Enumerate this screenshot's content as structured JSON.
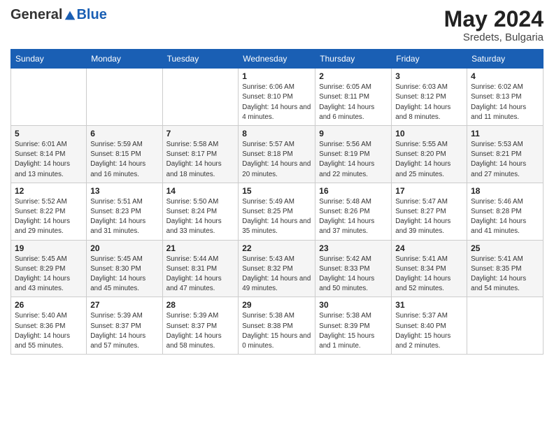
{
  "header": {
    "logo_general": "General",
    "logo_blue": "Blue",
    "month_year": "May 2024",
    "location": "Sredets, Bulgaria"
  },
  "weekdays": [
    "Sunday",
    "Monday",
    "Tuesday",
    "Wednesday",
    "Thursday",
    "Friday",
    "Saturday"
  ],
  "weeks": [
    [
      null,
      null,
      null,
      {
        "day": "1",
        "sunrise": "Sunrise: 6:06 AM",
        "sunset": "Sunset: 8:10 PM",
        "daylight": "Daylight: 14 hours and 4 minutes."
      },
      {
        "day": "2",
        "sunrise": "Sunrise: 6:05 AM",
        "sunset": "Sunset: 8:11 PM",
        "daylight": "Daylight: 14 hours and 6 minutes."
      },
      {
        "day": "3",
        "sunrise": "Sunrise: 6:03 AM",
        "sunset": "Sunset: 8:12 PM",
        "daylight": "Daylight: 14 hours and 8 minutes."
      },
      {
        "day": "4",
        "sunrise": "Sunrise: 6:02 AM",
        "sunset": "Sunset: 8:13 PM",
        "daylight": "Daylight: 14 hours and 11 minutes."
      }
    ],
    [
      {
        "day": "5",
        "sunrise": "Sunrise: 6:01 AM",
        "sunset": "Sunset: 8:14 PM",
        "daylight": "Daylight: 14 hours and 13 minutes."
      },
      {
        "day": "6",
        "sunrise": "Sunrise: 5:59 AM",
        "sunset": "Sunset: 8:15 PM",
        "daylight": "Daylight: 14 hours and 16 minutes."
      },
      {
        "day": "7",
        "sunrise": "Sunrise: 5:58 AM",
        "sunset": "Sunset: 8:17 PM",
        "daylight": "Daylight: 14 hours and 18 minutes."
      },
      {
        "day": "8",
        "sunrise": "Sunrise: 5:57 AM",
        "sunset": "Sunset: 8:18 PM",
        "daylight": "Daylight: 14 hours and 20 minutes."
      },
      {
        "day": "9",
        "sunrise": "Sunrise: 5:56 AM",
        "sunset": "Sunset: 8:19 PM",
        "daylight": "Daylight: 14 hours and 22 minutes."
      },
      {
        "day": "10",
        "sunrise": "Sunrise: 5:55 AM",
        "sunset": "Sunset: 8:20 PM",
        "daylight": "Daylight: 14 hours and 25 minutes."
      },
      {
        "day": "11",
        "sunrise": "Sunrise: 5:53 AM",
        "sunset": "Sunset: 8:21 PM",
        "daylight": "Daylight: 14 hours and 27 minutes."
      }
    ],
    [
      {
        "day": "12",
        "sunrise": "Sunrise: 5:52 AM",
        "sunset": "Sunset: 8:22 PM",
        "daylight": "Daylight: 14 hours and 29 minutes."
      },
      {
        "day": "13",
        "sunrise": "Sunrise: 5:51 AM",
        "sunset": "Sunset: 8:23 PM",
        "daylight": "Daylight: 14 hours and 31 minutes."
      },
      {
        "day": "14",
        "sunrise": "Sunrise: 5:50 AM",
        "sunset": "Sunset: 8:24 PM",
        "daylight": "Daylight: 14 hours and 33 minutes."
      },
      {
        "day": "15",
        "sunrise": "Sunrise: 5:49 AM",
        "sunset": "Sunset: 8:25 PM",
        "daylight": "Daylight: 14 hours and 35 minutes."
      },
      {
        "day": "16",
        "sunrise": "Sunrise: 5:48 AM",
        "sunset": "Sunset: 8:26 PM",
        "daylight": "Daylight: 14 hours and 37 minutes."
      },
      {
        "day": "17",
        "sunrise": "Sunrise: 5:47 AM",
        "sunset": "Sunset: 8:27 PM",
        "daylight": "Daylight: 14 hours and 39 minutes."
      },
      {
        "day": "18",
        "sunrise": "Sunrise: 5:46 AM",
        "sunset": "Sunset: 8:28 PM",
        "daylight": "Daylight: 14 hours and 41 minutes."
      }
    ],
    [
      {
        "day": "19",
        "sunrise": "Sunrise: 5:45 AM",
        "sunset": "Sunset: 8:29 PM",
        "daylight": "Daylight: 14 hours and 43 minutes."
      },
      {
        "day": "20",
        "sunrise": "Sunrise: 5:45 AM",
        "sunset": "Sunset: 8:30 PM",
        "daylight": "Daylight: 14 hours and 45 minutes."
      },
      {
        "day": "21",
        "sunrise": "Sunrise: 5:44 AM",
        "sunset": "Sunset: 8:31 PM",
        "daylight": "Daylight: 14 hours and 47 minutes."
      },
      {
        "day": "22",
        "sunrise": "Sunrise: 5:43 AM",
        "sunset": "Sunset: 8:32 PM",
        "daylight": "Daylight: 14 hours and 49 minutes."
      },
      {
        "day": "23",
        "sunrise": "Sunrise: 5:42 AM",
        "sunset": "Sunset: 8:33 PM",
        "daylight": "Daylight: 14 hours and 50 minutes."
      },
      {
        "day": "24",
        "sunrise": "Sunrise: 5:41 AM",
        "sunset": "Sunset: 8:34 PM",
        "daylight": "Daylight: 14 hours and 52 minutes."
      },
      {
        "day": "25",
        "sunrise": "Sunrise: 5:41 AM",
        "sunset": "Sunset: 8:35 PM",
        "daylight": "Daylight: 14 hours and 54 minutes."
      }
    ],
    [
      {
        "day": "26",
        "sunrise": "Sunrise: 5:40 AM",
        "sunset": "Sunset: 8:36 PM",
        "daylight": "Daylight: 14 hours and 55 minutes."
      },
      {
        "day": "27",
        "sunrise": "Sunrise: 5:39 AM",
        "sunset": "Sunset: 8:37 PM",
        "daylight": "Daylight: 14 hours and 57 minutes."
      },
      {
        "day": "28",
        "sunrise": "Sunrise: 5:39 AM",
        "sunset": "Sunset: 8:37 PM",
        "daylight": "Daylight: 14 hours and 58 minutes."
      },
      {
        "day": "29",
        "sunrise": "Sunrise: 5:38 AM",
        "sunset": "Sunset: 8:38 PM",
        "daylight": "Daylight: 15 hours and 0 minutes."
      },
      {
        "day": "30",
        "sunrise": "Sunrise: 5:38 AM",
        "sunset": "Sunset: 8:39 PM",
        "daylight": "Daylight: 15 hours and 1 minute."
      },
      {
        "day": "31",
        "sunrise": "Sunrise: 5:37 AM",
        "sunset": "Sunset: 8:40 PM",
        "daylight": "Daylight: 15 hours and 2 minutes."
      },
      null
    ]
  ]
}
